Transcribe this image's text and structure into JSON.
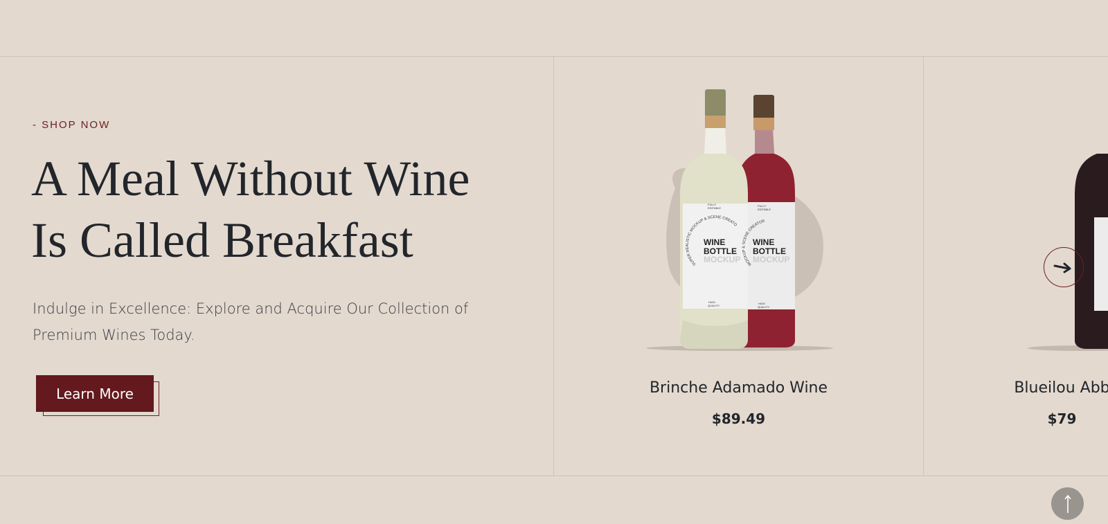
{
  "hero": {
    "eyebrow": "- SHOP NOW",
    "headline_line1": "A Meal Without Wine",
    "headline_line2": "Is Called Breakfast",
    "subtext": "Indulge in Excellence: Explore and Acquire Our Collection of Premium Wines Today.",
    "button_label": "Learn More"
  },
  "products": [
    {
      "name": "Brinche Adamado Wine",
      "price": "$89.49",
      "label_top": "FULLY EDITABLE",
      "label_arc": "SUPER REALISTIC MOCKUP & SCENE CREATOR",
      "label_title1": "WINE",
      "label_title2": "BOTTLE",
      "label_title3": "MOCKUP",
      "label_bottom": "HIGH QUALITY"
    },
    {
      "name": "Blueilou Abb",
      "price": "$79"
    }
  ],
  "icons": {
    "next": "arrow-right-icon",
    "scroll_top": "arrow-up-icon"
  },
  "colors": {
    "background": "#e3d9cf",
    "accent": "#63191d",
    "text": "#22262b"
  }
}
